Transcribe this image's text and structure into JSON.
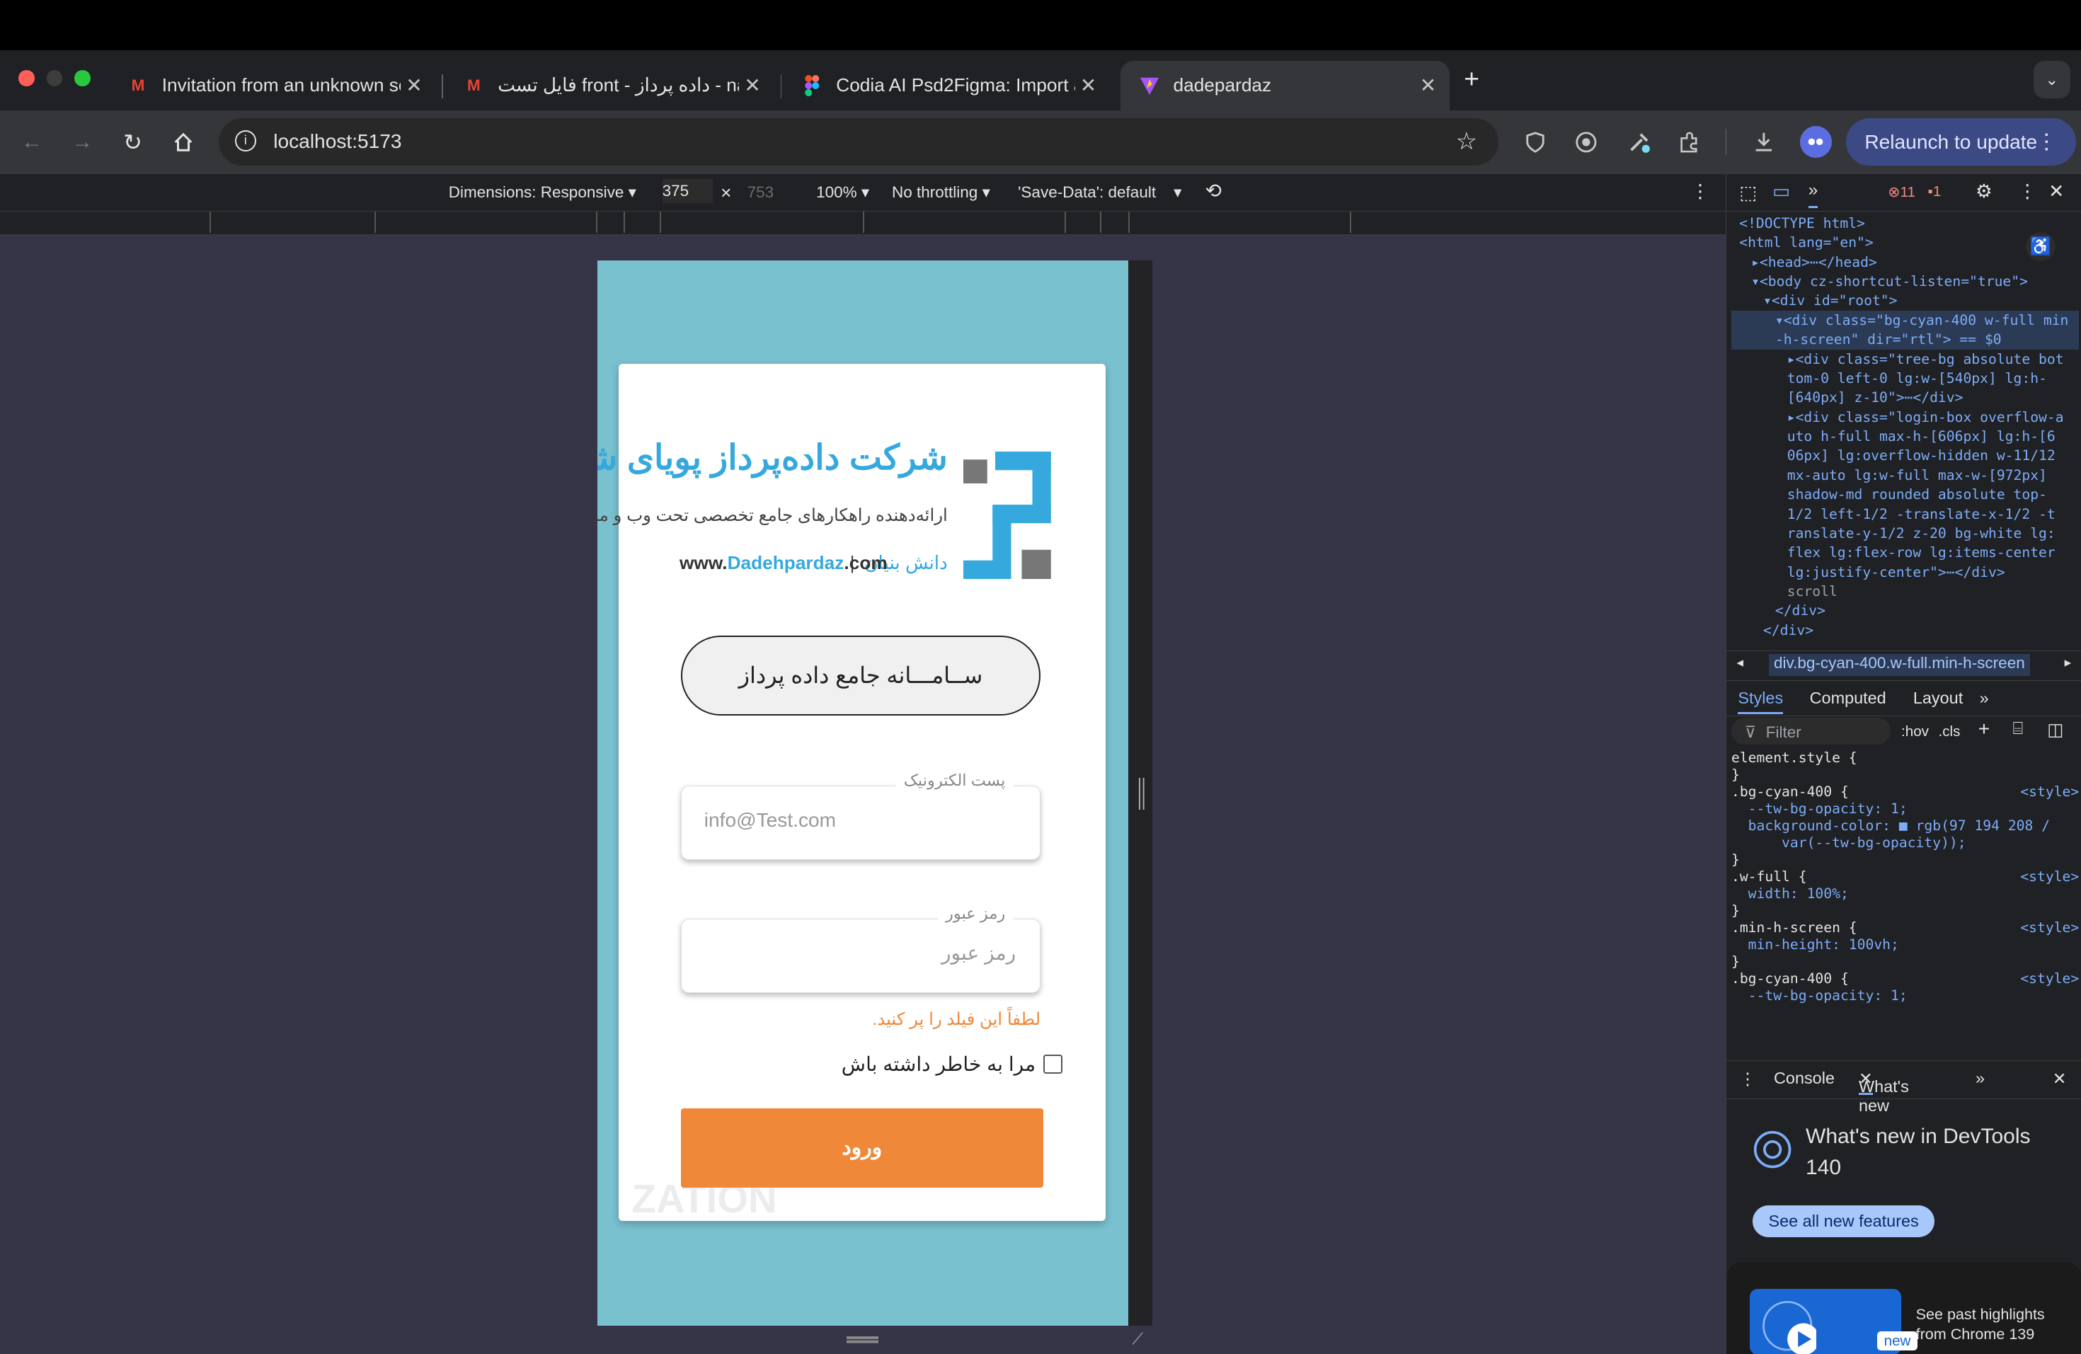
{
  "browser": {
    "tabs": [
      {
        "title": "Invitation from an unknown se",
        "icon": "gmail-icon"
      },
      {
        "title": "فایل تست front - داده پرداز - Gmail",
        "display": "فایل تست front - داده پرداز - nail",
        "icon": "gmail-icon"
      },
      {
        "title": "Codia AI Psd2Figma: Import a",
        "icon": "figma-icon"
      },
      {
        "title": "dadepardaz",
        "icon": "vite-icon"
      }
    ],
    "new_tab": "+",
    "url": "localhost:5173",
    "relaunch_label": "Relaunch to update"
  },
  "device_toolbar": {
    "dimensions": "Dimensions: Responsive",
    "width": "375",
    "times": "×",
    "height": "753",
    "zoom": "100%",
    "throttling": "No throttling",
    "save_data": "'Save-Data': default"
  },
  "page": {
    "logo": {
      "company": "شرکت داده‌پرداز پویای شریف",
      "tagline": "ارائه‌دهنده راهکارهای جامع تخصصی تحت وب و موبایل",
      "website_prefix": "www.",
      "website_name": "Dadehpardaz",
      "website_suffix": ".com",
      "separator": "|",
      "knowledge_based": "دانش بنیان"
    },
    "system_title": "ســامـــانه جامع داده پرداز",
    "email": {
      "label": "پست الکترونیک",
      "placeholder": "info@Test.com"
    },
    "password": {
      "label": "رمز عبور",
      "placeholder": "رمز عبور"
    },
    "error": "لطفاً این فیلد را پر کنید.",
    "remember_me": "مرا به خاطر داشته باش",
    "login_button": "ورود",
    "background_text": "ZATION"
  },
  "devtools": {
    "errors": "11",
    "warnings": "1",
    "elements": [
      {
        "t": "<!DOCTYPE html>"
      },
      {
        "t": "<html lang=\"en\">"
      },
      {
        "t": "▸<head>⋯</head>"
      },
      {
        "t": "▾<body cz-shortcut-listen=\"true\">"
      },
      {
        "t": "▾<div id=\"root\">"
      },
      {
        "t": "▾<div class=\"bg-cyan-400 w-full min"
      },
      {
        "t": "-h-screen\" dir=\"rtl\"> == $0"
      },
      {
        "t": "▸<div class=\"tree-bg absolute bot"
      },
      {
        "t": "tom-0 left-0 lg:w-[540px] lg:h-"
      },
      {
        "t": "[640px] z-10\">⋯</div>"
      },
      {
        "t": "▸<div class=\"login-box overflow-a"
      },
      {
        "t": "uto h-full max-h-[606px] lg:h-[6"
      },
      {
        "t": "06px] lg:overflow-hidden w-11/12"
      },
      {
        "t": "mx-auto lg:w-full max-w-[972px]"
      },
      {
        "t": "shadow-md rounded absolute top-"
      },
      {
        "t": "1/2 left-1/2 -translate-x-1/2 -t"
      },
      {
        "t": "ranslate-y-1/2 z-20 bg-white lg:"
      },
      {
        "t": "flex lg:flex-row lg:items-center"
      },
      {
        "t": "lg:justify-center\">⋯</div>"
      },
      {
        "t": "scroll"
      },
      {
        "t": "</div>"
      },
      {
        "t": "</div>"
      }
    ],
    "breadcrumb": "div.bg-cyan-400.w-full.min-h-screen",
    "panel_tabs": [
      "Styles",
      "Computed",
      "Layout"
    ],
    "filter_placeholder": "Filter",
    "filter_tools": [
      ":hov",
      ".cls"
    ],
    "styles": [
      {
        "t": "element.style {"
      },
      {
        "t": "}"
      },
      {
        "t": ".bg-cyan-400 {",
        "src": "<style>"
      },
      {
        "t": "  --tw-bg-opacity: 1;"
      },
      {
        "t": "  background-color: ■ rgb(97 194 208 /"
      },
      {
        "t": "      var(--tw-bg-opacity));"
      },
      {
        "t": "}"
      },
      {
        "t": ".w-full {",
        "src": "<style>"
      },
      {
        "t": "  width: 100%;"
      },
      {
        "t": "}"
      },
      {
        "t": ".min-h-screen {",
        "src": "<style>"
      },
      {
        "t": "  min-height: 100vh;"
      },
      {
        "t": "}"
      },
      {
        "t": ".bg-cyan-400 {",
        "src": "<style>"
      },
      {
        "t": "  --tw-bg-opacity: 1;"
      }
    ],
    "drawer_tabs": [
      "Console",
      "What's new"
    ],
    "whats_new_title": "What's new in DevTools 140",
    "see_all": "See all new features",
    "highlight_badge": "new",
    "highlight_text": "See past highlights from Chrome 139"
  },
  "colors": {
    "page_bg": "#7ac1d0",
    "accent": "#f0883a",
    "relaunch": "#3b4a85"
  }
}
